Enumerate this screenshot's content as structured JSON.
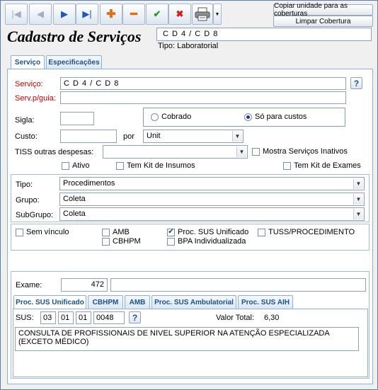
{
  "toolbar": {
    "icons": [
      "first-icon",
      "prev-icon",
      "next-icon",
      "last-icon",
      "add-icon",
      "remove-icon",
      "confirm-icon",
      "cancel-icon",
      "printer-icon",
      "dropdown-icon"
    ],
    "glyphs": {
      "first": "|◀",
      "prev": "◀",
      "next": "▶",
      "last": "▶|",
      "add": "✚",
      "remove": "━",
      "confirm": "✔",
      "cancel": "✖",
      "dropdown": "▼"
    },
    "copy_button": "Copiar unidade para as coberturas",
    "clear_button": "Limpar Cobertura"
  },
  "header": {
    "title": "Cadastro de Serviços",
    "code": "C D 4 / C D 8",
    "type_label": "Tipo: Laboratorial"
  },
  "tabs": [
    "Serviço",
    "Especificações"
  ],
  "form": {
    "servico_label": "Serviço:",
    "servico_value": "C D 4 / C D 8",
    "help_glyph": "?",
    "servguia_label": "Serv.p/guia:",
    "servguia_value": "",
    "sigla_label": "Sigla:",
    "sigla_value": "",
    "radio_cobrado": "Cobrado",
    "radio_custos": "Só para custos",
    "radio_selected": "Só para custos",
    "custo_label": "Custo:",
    "custo_value": "",
    "por_label": "por",
    "unit_value": "Unit",
    "tiss_label": "TISS outras despesas:",
    "tiss_value": "",
    "mostra_inativos": "Mostra Serviços Inativos",
    "ativo": "Ativo",
    "kit_insumos": "Tem Kit de Insumos",
    "kit_exames": "Tem Kit de Exames"
  },
  "classification": {
    "tipo_label": "Tipo:",
    "tipo_value": "Procedimentos",
    "grupo_label": "Grupo:",
    "grupo_value": "Coleta",
    "subgrupo_label": "SubGrupo:",
    "subgrupo_value": "Coleta"
  },
  "vinculos": {
    "sem_vinculo": "Sem vínculo",
    "amb": "AMB",
    "cbhpm": "CBHPM",
    "sus_unificado": "Proc. SUS Unificado",
    "bpa": "BPA Individualizada",
    "tuss": "TUSS/PROCEDIMENTO",
    "checked_mark": "✔"
  },
  "exame": {
    "label": "Exame:",
    "code": "472",
    "name": ""
  },
  "subtabs": [
    "Proc. SUS Unificado",
    "CBHPM",
    "AMB",
    "Proc. SUS Ambulatorial",
    "Proc. SUS AIH"
  ],
  "sus": {
    "label": "SUS:",
    "p1": "03",
    "p2": "01",
    "p3": "01",
    "p4": "0048",
    "valor_label": "Valor Total:",
    "valor": "6,30",
    "description": "CONSULTA DE PROFISSIONAIS DE NIVEL SUPERIOR NA ATENÇÃO ESPECIALIZADA (EXCETO MÉDICO)"
  }
}
